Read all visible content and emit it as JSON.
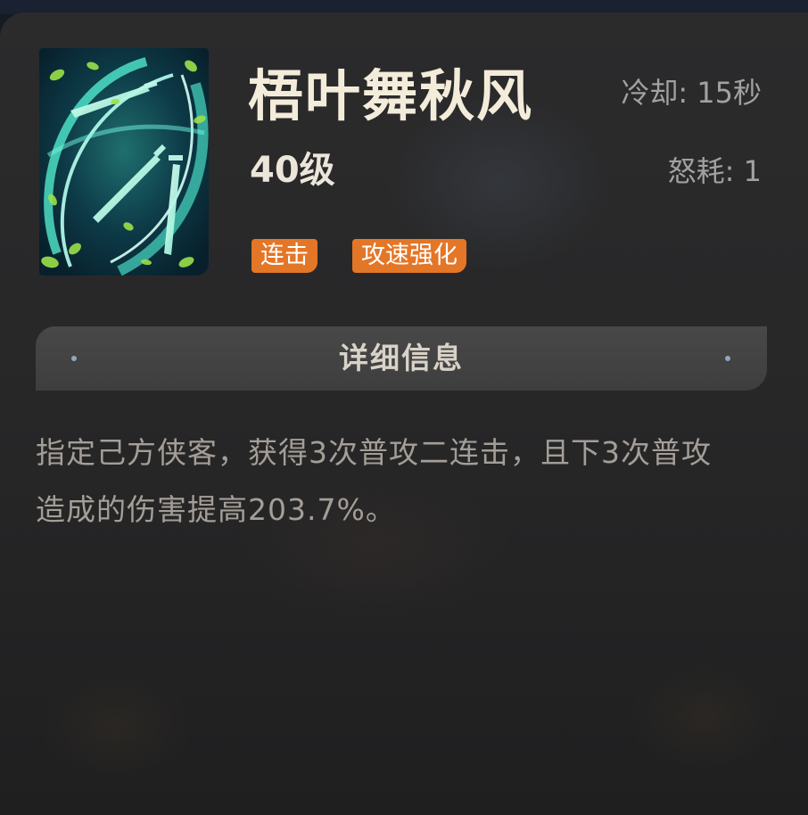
{
  "skill": {
    "name": "梧叶舞秋风",
    "level": "40级",
    "cooldown": "冷却: 15秒",
    "rage_cost": "怒耗: 1",
    "icon": "sword-swirl-skill-icon",
    "tags": [
      "连击",
      "攻速强化"
    ]
  },
  "details": {
    "header": "详细信息",
    "description": "指定己方侠客，获得3次普攻二连击，且下3次普攻造成的伤害提高203.7%。"
  },
  "colors": {
    "tag_background": "#e47627",
    "title_text": "#f4ecda",
    "muted_text": "#a3a1a0",
    "panel_background": "#2b2b2c",
    "header_bar": "#484848"
  }
}
